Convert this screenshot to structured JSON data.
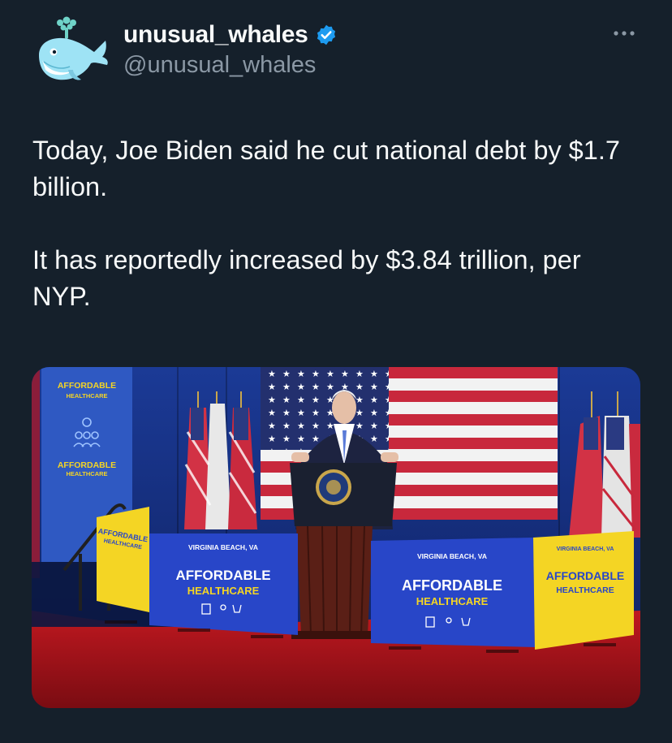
{
  "author": {
    "display_name": "unusual_whales",
    "handle": "@unusual_whales",
    "verified": true,
    "verified_color": "#1d9bf0"
  },
  "tweet": {
    "paragraphs": [
      "Today, Joe Biden said he cut national debt by $1.7 billion.",
      "It has reportedly increased by $3.84 trillion, per NYP."
    ]
  },
  "media": {
    "banner_left": {
      "line1": "AFFORDABLE",
      "line2": "HEALTHCARE"
    },
    "sign_location": "VIRGINIA BEACH, VA",
    "sign_title": "AFFORDABLE",
    "sign_subtitle": "HEALTHCARE",
    "colors": {
      "backdrop": "#1f3a93",
      "sign_blue": "#2846c8",
      "sign_yellow": "#f4d524",
      "stage_red": "#b3141c",
      "flag_red": "#c8283c"
    }
  },
  "icons": {
    "more": "more-horizontal-icon",
    "verified": "verified-badge-icon",
    "avatar": "whale-avatar-icon"
  }
}
